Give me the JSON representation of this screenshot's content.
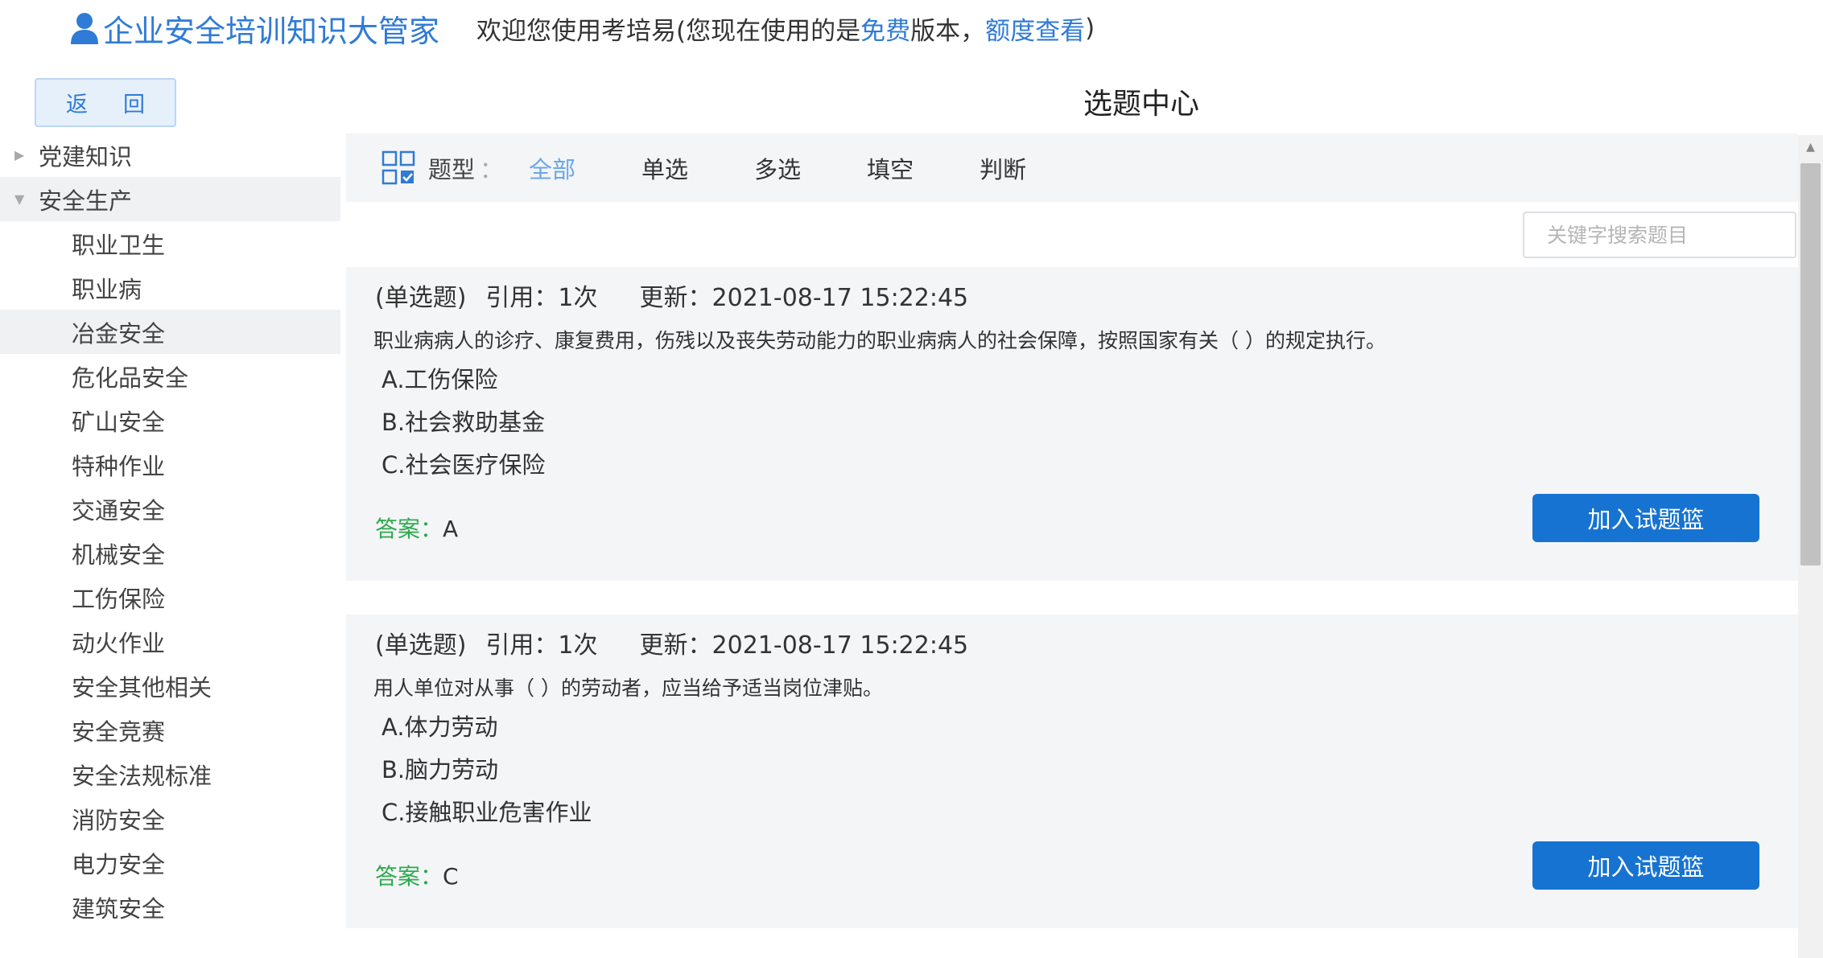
{
  "header": {
    "brand": "企业安全培训知识大管家",
    "welcome_prefix": "欢迎您使用考培易(您现在使用的是",
    "free_link": "免费",
    "welcome_mid": "版本，",
    "quota_link": "额度查看",
    "welcome_suffix": ")"
  },
  "sidebar": {
    "back_label_1": "返",
    "back_label_2": "回",
    "tree": [
      {
        "label": "党建知识",
        "expanded": false
      },
      {
        "label": "安全生产",
        "expanded": true,
        "children": [
          "职业卫生",
          "职业病",
          "冶金安全",
          "危化品安全",
          "矿山安全",
          "特种作业",
          "交通安全",
          "机械安全",
          "工伤保险",
          "动火作业",
          "安全其他相关",
          "安全竞赛",
          "安全法规标准",
          "消防安全",
          "电力安全",
          "建筑安全"
        ],
        "active_child": "冶金安全"
      }
    ]
  },
  "main": {
    "title": "选题中心",
    "filter": {
      "label": "题型",
      "colon": "：",
      "options": [
        "全部",
        "单选",
        "多选",
        "填空",
        "判断"
      ],
      "active": "全部"
    },
    "search": {
      "placeholder": "关键字搜索题目"
    },
    "questions": [
      {
        "type": "(单选题)",
        "cite": "引用：1次",
        "updated": "更新：2021-08-17 15:22:45",
        "text": "职业病病人的诊疗、康复费用，伤残以及丧失劳动能力的职业病病人的社会保障，按照国家有关（ ）的规定执行。",
        "options": [
          "A.工伤保险",
          "B.社会救助基金",
          "C.社会医疗保险"
        ],
        "answer_label": "答案：",
        "answer": "A",
        "add_label": "加入试题篮"
      },
      {
        "type": "(单选题)",
        "cite": "引用：1次",
        "updated": "更新：2021-08-17 15:22:45",
        "text": "用人单位对从事（ ）的劳动者，应当给予适当岗位津贴。",
        "options": [
          "A.体力劳动",
          "B.脑力劳动",
          "C.接触职业危害作业"
        ],
        "answer_label": "答案：",
        "answer": "C",
        "add_label": "加入试题篮"
      }
    ]
  },
  "colors": {
    "accent": "#2f7bd6",
    "button": "#1673d1",
    "answer_green": "#2eaa4e",
    "panel": "#f4f5f7"
  },
  "icons": {
    "brand": "user-icon",
    "filter": "grid-check-icon",
    "search": "search-icon"
  }
}
